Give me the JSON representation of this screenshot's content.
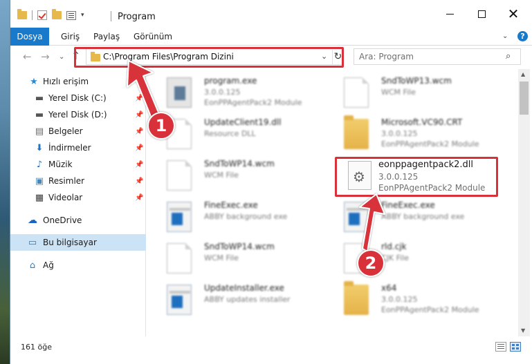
{
  "window": {
    "title": "Program",
    "min_glyph": "",
    "close_glyph": "✕"
  },
  "ribbon": {
    "tabs": [
      "Dosya",
      "Giriş",
      "Paylaş",
      "Görünüm"
    ],
    "help_glyph": "?"
  },
  "address": {
    "path": "C:\\Program Files\\Program Dizini",
    "search_placeholder": "Ara: Program"
  },
  "navpane": {
    "items": [
      {
        "label": "Hızlı erişim",
        "icon": "star-icon",
        "pinned": false
      },
      {
        "label": "Yerel Disk (C:)",
        "icon": "drive-icon",
        "pinned": true
      },
      {
        "label": "Yerel Disk (D:)",
        "icon": "drive-icon",
        "pinned": true
      },
      {
        "label": "Belgeler",
        "icon": "documents-icon",
        "pinned": true
      },
      {
        "label": "İndirmeler",
        "icon": "downloads-icon",
        "pinned": true
      },
      {
        "label": "Müzik",
        "icon": "music-icon",
        "pinned": true
      },
      {
        "label": "Resimler",
        "icon": "pictures-icon",
        "pinned": true
      },
      {
        "label": "Videolar",
        "icon": "videos-icon",
        "pinned": true
      },
      {
        "label": "OneDrive",
        "icon": "onedrive-icon",
        "pinned": false
      },
      {
        "label": "Bu bilgisayar",
        "icon": "this-pc-icon",
        "pinned": false,
        "selected": true
      },
      {
        "label": "Ağ",
        "icon": "network-icon",
        "pinned": false
      }
    ]
  },
  "files": {
    "left_column": [
      {
        "name": "program.exe",
        "sub1": "3.0.0.125",
        "sub2": "EonPPAgentPack2 Module",
        "kind": "setup"
      },
      {
        "name": "UpdateClient19.dll",
        "sub1": "Resource DLL",
        "sub2": "",
        "kind": "page"
      },
      {
        "name": "SndToWP14.wcm",
        "sub1": "WCM File",
        "sub2": "",
        "kind": "page"
      },
      {
        "name": "FineExec.exe",
        "sub1": "ABBY background exe",
        "sub2": "",
        "kind": "exe"
      },
      {
        "name": "SndToWP14.wcm",
        "sub1": "WCM File",
        "sub2": "",
        "kind": "page"
      },
      {
        "name": "UpdateInstaller.exe",
        "sub1": "ABBY updates installer",
        "sub2": "",
        "kind": "exe"
      }
    ],
    "right_column": [
      {
        "name": "SndToWP13.wcm",
        "sub1": "WCM File",
        "sub2": "",
        "kind": "page"
      },
      {
        "name": "Microsoft.VC90.CRT",
        "sub1": "3.0.0.125",
        "sub2": "EonPPAgentPack2 Module",
        "kind": "folder"
      },
      {
        "name": "FineExec.exe",
        "sub1": "ABBY background exe",
        "sub2": "",
        "kind": "exe"
      },
      {
        "name": "rld.cjk",
        "sub1": "CJK File",
        "sub2": "",
        "kind": "page"
      },
      {
        "name": "x64",
        "sub1": "3.0.0.125",
        "sub2": "EonPPAgentPack2 Module",
        "kind": "folder"
      }
    ],
    "highlighted": {
      "name": "eonppagentpack2.dll",
      "version": "3.0.0.125",
      "description": "EonPPAgentPack2 Module"
    }
  },
  "status": {
    "count": "161 öğe"
  },
  "callouts": {
    "step1": "1",
    "step2": "2",
    "color": "#d8313a"
  },
  "colors": {
    "accent": "#1979ca",
    "selection": "#cce3f5",
    "highlight": "#d8313a"
  }
}
